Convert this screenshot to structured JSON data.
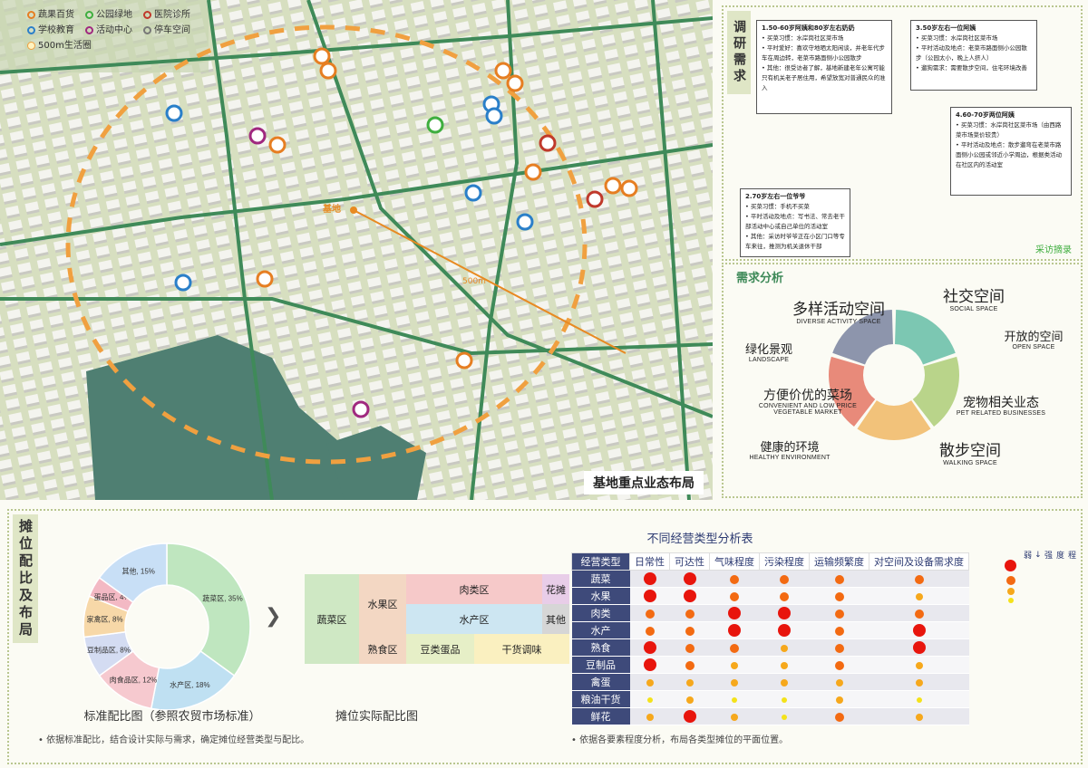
{
  "map": {
    "legend": {
      "items": [
        {
          "label": "蔬果百货",
          "color": "#e67e22"
        },
        {
          "label": "公园绿地",
          "color": "#3fae3f"
        },
        {
          "label": "医院诊所",
          "color": "#c0392b"
        },
        {
          "label": "学校教育",
          "color": "#2a7fc9"
        },
        {
          "label": "活动中心",
          "color": "#a0287f"
        },
        {
          "label": "停车空间",
          "color": "#777777"
        }
      ],
      "circle_label": "500m生活圈"
    },
    "site_label": "基地",
    "distance_label": "500m",
    "caption": "基地重点业态布局"
  },
  "research": {
    "title": "调研需求",
    "notes": [
      {
        "head": "1.50-60岁阿姨和80岁左右奶奶",
        "lines": [
          "• 买菜习惯：水岸岗社区菜市场",
          "• 平时爱好：喜欢守地晒太阳闲谈，并老年代步车在周边转，老菜市路面侧小公园散步",
          "• 其他：很受访者了解，基地新建老年公寓可能只有机关老子居住用，希望放宽对普通民众的准入"
        ]
      },
      {
        "head": "3.50岁左右一位阿姨",
        "lines": [
          "• 买菜习惯：水岸岗社区菜市场",
          "• 平时活动及地点：老菜市路面侧小公园散步（公园太小，晚上人挤人）",
          "• 遛狗需求：需要散步空间，住宅环境改善"
        ]
      },
      {
        "head": "4.60-70岁两位阿姨",
        "lines": [
          "• 买菜习惯：水岸岗社区菜市场（由西路菜市场菜价较贵）",
          "• 平时活动及地点：散步遛弯在老菜市路面侧小公园或邻近小学周边，根据类活动在社区内的活动室"
        ]
      },
      {
        "head": "2.70岁左右一位爷爷",
        "lines": [
          "• 买菜习惯：手机不买菜",
          "• 平时活动及地点：写书法、常去老干部活动中心或自己单位的活动室",
          "• 其他：采访时爷爷正在小区门口等专车来往，推测为机关退休干部"
        ]
      }
    ],
    "photo_label": "采访摘录"
  },
  "analysis": {
    "title": "需求分析",
    "labels": [
      {
        "zh": "多样活动空间",
        "en": "DIVERSE ACTIVITY SPACE"
      },
      {
        "zh": "社交空间",
        "en": "SOCIAL SPACE"
      },
      {
        "zh": "开放的空间",
        "en": "OPEN SPACE"
      },
      {
        "zh": "绿化景观",
        "en": "LANDSCAPE"
      },
      {
        "zh": "方便价优的菜场",
        "en": "CONVENIENT AND LOW PRICE VEGETABLE MARKET"
      },
      {
        "zh": "宠物相关业态",
        "en": "PET RELATED BUSINESSES"
      },
      {
        "zh": "健康的环境",
        "en": "HEALTHY ENVIRONMENT"
      },
      {
        "zh": "散步空间",
        "en": "WALKING SPACE"
      }
    ],
    "ring_colors": [
      "#7cc7b2",
      "#b9d48a",
      "#f2c27a",
      "#e88a7a",
      "#8d95ac"
    ]
  },
  "bottom": {
    "title": "摊位配比及布局",
    "donut": {
      "caption": "标准配比图（参照农贸市场标准）",
      "segments": [
        {
          "label": "蔬菜区, 35%",
          "value": 35,
          "color": "#bfe6bf"
        },
        {
          "label": "水产区, 18%",
          "value": 18,
          "color": "#bfe0f2"
        },
        {
          "label": "肉食品区, 12%",
          "value": 12,
          "color": "#f6c9cf"
        },
        {
          "label": "豆制品区, 8%",
          "value": 8,
          "color": "#d4dcf2"
        },
        {
          "label": "家禽区, 8%",
          "value": 8,
          "color": "#f7d8a8"
        },
        {
          "label": "蛋品区, 4%",
          "value": 4,
          "color": "#f3b9c4"
        },
        {
          "label": "其他, 15%",
          "value": 15,
          "color": "#c8dff6"
        }
      ]
    },
    "actual": {
      "caption": "摊位实际配比图",
      "cells": [
        "蔬菜区",
        "水果区",
        "肉类区",
        "花摊",
        "水产区",
        "其他",
        "熟食区",
        "豆类蛋品",
        "干货调味"
      ]
    },
    "note_left": "• 依据标准配比，结合设计实际与需求，确定摊位经营类型与配比。",
    "table": {
      "title": "不同经营类型分析表",
      "headers": [
        "经营类型",
        "日常性",
        "可达性",
        "气味程度",
        "污染程度",
        "运输频繁度",
        "对空间及设备需求度"
      ],
      "rows": [
        {
          "name": "蔬菜",
          "levels": [
            5,
            5,
            3,
            3,
            3,
            3
          ]
        },
        {
          "name": "水果",
          "levels": [
            5,
            5,
            3,
            3,
            3,
            2
          ]
        },
        {
          "name": "肉类",
          "levels": [
            3,
            3,
            5,
            5,
            3,
            3
          ]
        },
        {
          "name": "水产",
          "levels": [
            3,
            3,
            5,
            5,
            3,
            5
          ]
        },
        {
          "name": "熟食",
          "levels": [
            5,
            3,
            3,
            2,
            3,
            5
          ]
        },
        {
          "name": "豆制品",
          "levels": [
            5,
            3,
            2,
            2,
            3,
            2
          ]
        },
        {
          "name": "禽蛋",
          "levels": [
            2,
            2,
            2,
            2,
            2,
            2
          ]
        },
        {
          "name": "粮油干货",
          "levels": [
            1,
            2,
            1,
            1,
            2,
            1
          ]
        },
        {
          "name": "鲜花",
          "levels": [
            2,
            5,
            2,
            1,
            3,
            2
          ]
        }
      ],
      "scale_label": "程度强→弱",
      "level_colors": {
        "5": "#e8150d",
        "3": "#f36a12",
        "2": "#f6a81c",
        "1": "#f4e21a"
      }
    },
    "note_right": "• 依据各要素程度分析，布局各类型摊位的平面位置。"
  }
}
